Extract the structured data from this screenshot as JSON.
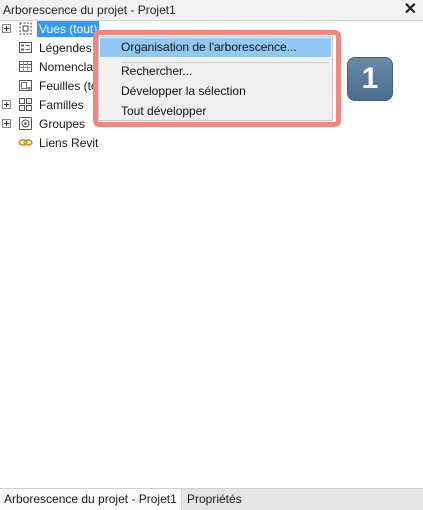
{
  "panel": {
    "title": "Arborescence du projet - Projet1",
    "close_label": "✕"
  },
  "tree": {
    "items": [
      {
        "label": "Vues (tout)",
        "icon": "views-icon"
      },
      {
        "label": "Légendes",
        "icon": "legend-icon"
      },
      {
        "label": "Nomencla",
        "icon": "schedule-icon"
      },
      {
        "label": "Feuilles (to",
        "icon": "sheet-icon"
      },
      {
        "label": "Familles",
        "icon": "families-icon"
      },
      {
        "label": "Groupes",
        "icon": "groups-icon"
      },
      {
        "label": "Liens Revit",
        "icon": "revit-links-icon"
      }
    ]
  },
  "context_menu": {
    "items": [
      "Organisation de l'arborescence...",
      "Rechercher...",
      "Développer la sélection",
      "Tout développer"
    ]
  },
  "callout": {
    "number": "1",
    "border_color": "#f2877d"
  },
  "bottom_tabs": [
    "Arborescence du projet - Projet1",
    "Propriétés"
  ],
  "colors": {
    "selection": "#3399ff",
    "menu_highlight": "#91c9f7"
  }
}
